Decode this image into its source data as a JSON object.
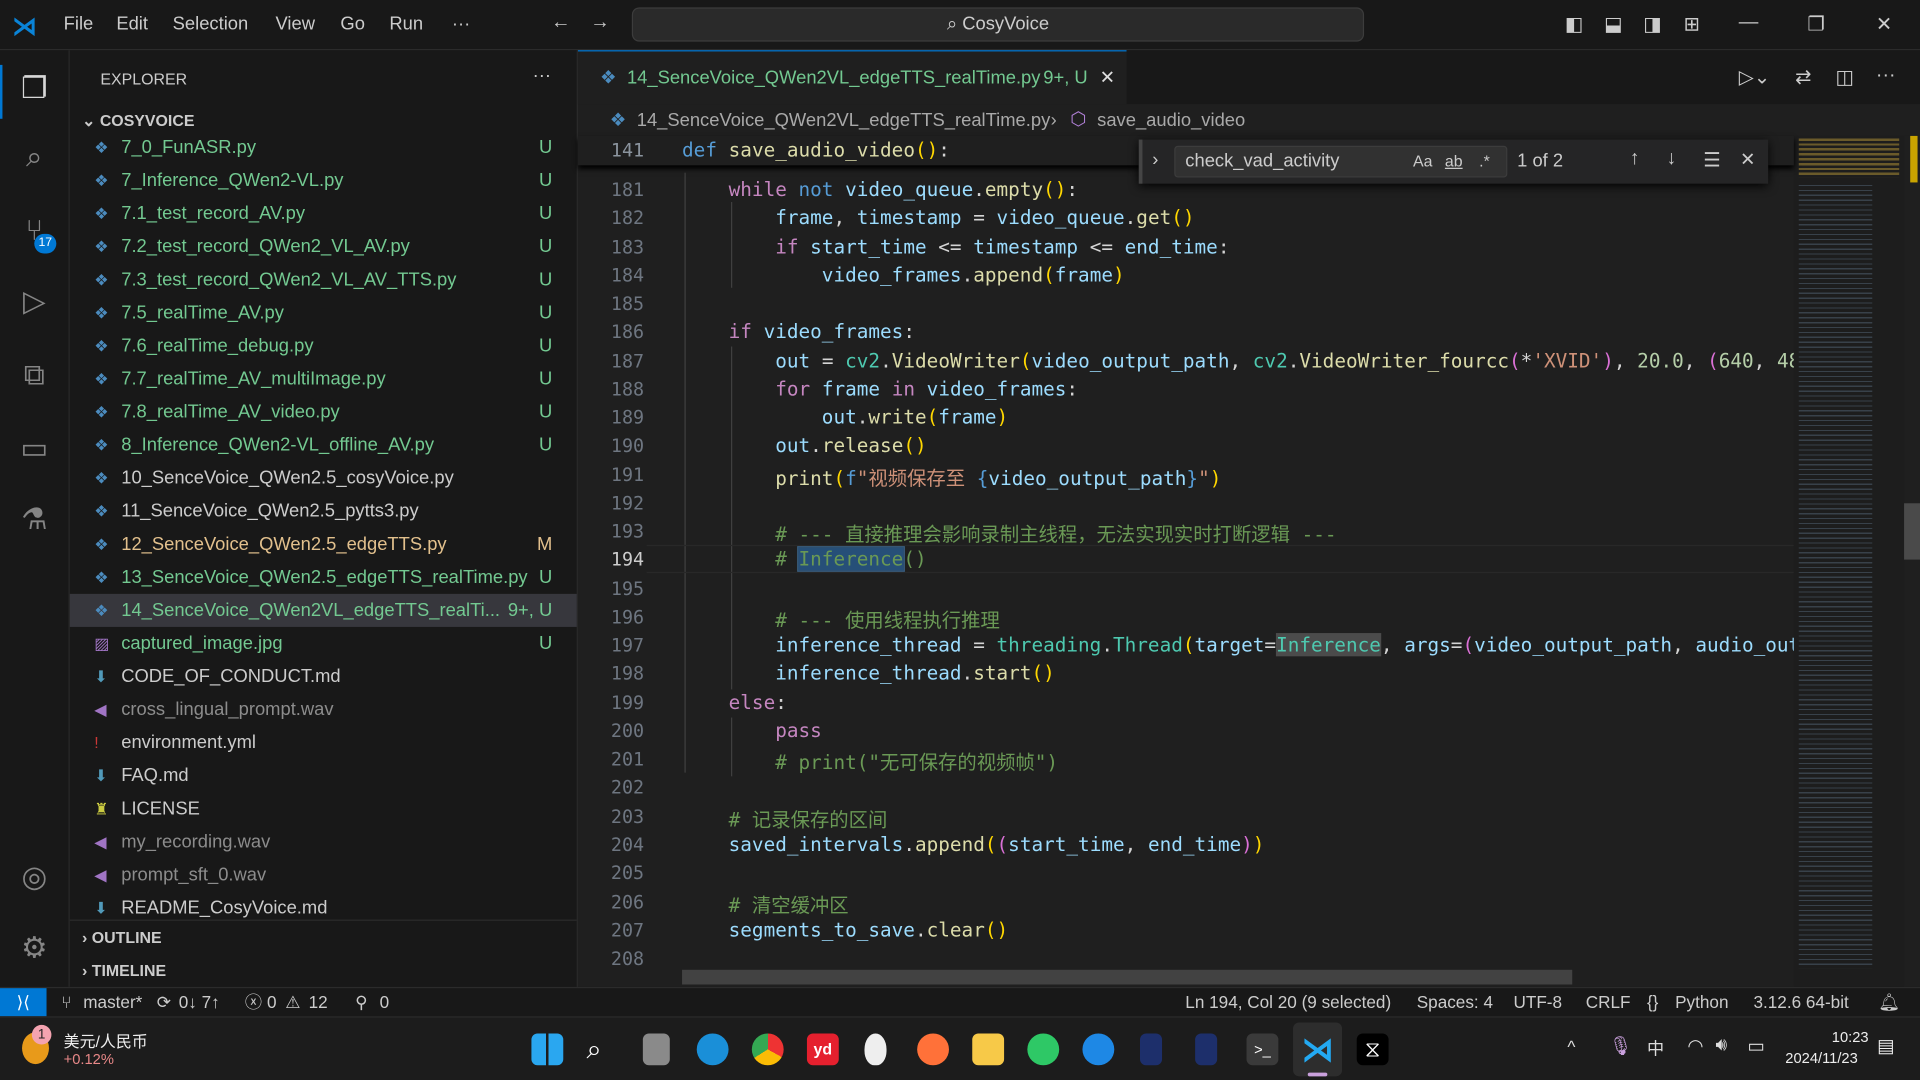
{
  "title_bar": {
    "menus": [
      "File",
      "Edit",
      "Selection",
      "View",
      "Go",
      "Run",
      "···"
    ],
    "search": "CosyVoice"
  },
  "activity_bar": {
    "source_control_badge": "17"
  },
  "explorer": {
    "title": "EXPLORER",
    "more": "···",
    "folder": "COSYVOICE",
    "files": [
      {
        "name": "7_0_FunASR.py",
        "status": "U",
        "type": "py",
        "color": "#73c991"
      },
      {
        "name": "7_Inference_QWen2-VL.py",
        "status": "U",
        "type": "py",
        "color": "#73c991"
      },
      {
        "name": "7.1_test_record_AV.py",
        "status": "U",
        "type": "py",
        "color": "#73c991"
      },
      {
        "name": "7.2_test_record_QWen2_VL_AV.py",
        "status": "U",
        "type": "py",
        "color": "#73c991"
      },
      {
        "name": "7.3_test_record_QWen2_VL_AV_TTS.py",
        "status": "U",
        "type": "py",
        "color": "#73c991"
      },
      {
        "name": "7.5_realTime_AV.py",
        "status": "U",
        "type": "py",
        "color": "#73c991"
      },
      {
        "name": "7.6_realTime_debug.py",
        "status": "U",
        "type": "py",
        "color": "#73c991"
      },
      {
        "name": "7.7_realTime_AV_multiImage.py",
        "status": "U",
        "type": "py",
        "color": "#73c991"
      },
      {
        "name": "7.8_realTime_AV_video.py",
        "status": "U",
        "type": "py",
        "color": "#73c991"
      },
      {
        "name": "8_Inference_QWen2-VL_offline_AV.py",
        "status": "U",
        "type": "py",
        "color": "#73c991"
      },
      {
        "name": "10_SenceVoice_QWen2.5_cosyVoice.py",
        "status": "",
        "type": "py",
        "color": "#cccccc"
      },
      {
        "name": "11_SenceVoice_QWen2.5_pytts3.py",
        "status": "",
        "type": "py",
        "color": "#cccccc"
      },
      {
        "name": "12_SenceVoice_QWen2.5_edgeTTS.py",
        "status": "M",
        "type": "py",
        "color": "#e2c08d"
      },
      {
        "name": "13_SenceVoice_QWen2.5_edgeTTS_realTime.py",
        "status": "U",
        "type": "py",
        "color": "#73c991"
      },
      {
        "name": "14_SenceVoice_QWen2VL_edgeTTS_realTi...",
        "status": "9+, U",
        "type": "py",
        "color": "#73c991",
        "selected": true
      },
      {
        "name": "captured_image.jpg",
        "status": "U",
        "type": "img",
        "color": "#73c991"
      },
      {
        "name": "CODE_OF_CONDUCT.md",
        "status": "",
        "type": "md",
        "color": "#cccccc"
      },
      {
        "name": "cross_lingual_prompt.wav",
        "status": "",
        "type": "wav",
        "color": "#8c8c8c"
      },
      {
        "name": "environment.yml",
        "status": "",
        "type": "yml",
        "color": "#cccccc"
      },
      {
        "name": "FAQ.md",
        "status": "",
        "type": "md",
        "color": "#cccccc"
      },
      {
        "name": "LICENSE",
        "status": "",
        "type": "lic",
        "color": "#cccccc"
      },
      {
        "name": "my_recording.wav",
        "status": "",
        "type": "wav",
        "color": "#8c8c8c"
      },
      {
        "name": "prompt_sft_0.wav",
        "status": "",
        "type": "wav",
        "color": "#8c8c8c"
      },
      {
        "name": "README_CosyVoice.md",
        "status": "",
        "type": "md",
        "color": "#cccccc"
      }
    ],
    "outline": "OUTLINE",
    "timeline": "TIMELINE"
  },
  "editor": {
    "tab": {
      "label": "14_SenceVoice_QWen2VL_edgeTTS_realTime.py",
      "badge": "9+, U"
    },
    "breadcrumb": {
      "file": "14_SenceVoice_QWen2VL_edgeTTS_realTime.py",
      "symbol": "save_audio_video"
    },
    "sticky": {
      "line": "141",
      "tokens": [
        [
          "bl",
          "def"
        ],
        [
          "op",
          " "
        ],
        [
          "fn",
          "save_audio_video"
        ],
        [
          "br",
          "()"
        ],
        [
          "op",
          ":"
        ]
      ]
    },
    "find": {
      "query": "check_vad_activity",
      "case": "Aa",
      "word": "ab",
      "regex": ".*",
      "result": "1 of 2"
    },
    "lines": [
      {
        "n": "181",
        "t": [
          [
            "op",
            "    "
          ],
          [
            "kw",
            "while"
          ],
          [
            "op",
            " "
          ],
          [
            "bl",
            "not"
          ],
          [
            "op",
            " "
          ],
          [
            "var",
            "video_queue"
          ],
          [
            "op",
            "."
          ],
          [
            "fn",
            "empty"
          ],
          [
            "br",
            "()"
          ],
          [
            "op",
            ":"
          ]
        ]
      },
      {
        "n": "182",
        "t": [
          [
            "op",
            "        "
          ],
          [
            "var",
            "frame"
          ],
          [
            "op",
            ", "
          ],
          [
            "var",
            "timestamp"
          ],
          [
            "op",
            " = "
          ],
          [
            "var",
            "video_queue"
          ],
          [
            "op",
            "."
          ],
          [
            "fn",
            "get"
          ],
          [
            "br",
            "()"
          ]
        ]
      },
      {
        "n": "183",
        "t": [
          [
            "op",
            "        "
          ],
          [
            "kw",
            "if"
          ],
          [
            "op",
            " "
          ],
          [
            "var",
            "start_time"
          ],
          [
            "op",
            " <= "
          ],
          [
            "var",
            "timestamp"
          ],
          [
            "op",
            " <= "
          ],
          [
            "var",
            "end_time"
          ],
          [
            "op",
            ":"
          ]
        ]
      },
      {
        "n": "184",
        "t": [
          [
            "op",
            "            "
          ],
          [
            "var",
            "video_frames"
          ],
          [
            "op",
            "."
          ],
          [
            "fn",
            "append"
          ],
          [
            "br",
            "("
          ],
          [
            "var",
            "frame"
          ],
          [
            "br",
            ")"
          ]
        ]
      },
      {
        "n": "185",
        "t": []
      },
      {
        "n": "186",
        "t": [
          [
            "op",
            "    "
          ],
          [
            "kw",
            "if"
          ],
          [
            "op",
            " "
          ],
          [
            "var",
            "video_frames"
          ],
          [
            "op",
            ":"
          ]
        ]
      },
      {
        "n": "187",
        "t": [
          [
            "op",
            "        "
          ],
          [
            "var",
            "out"
          ],
          [
            "op",
            " = "
          ],
          [
            "cls",
            "cv2"
          ],
          [
            "op",
            "."
          ],
          [
            "fn",
            "VideoWriter"
          ],
          [
            "br",
            "("
          ],
          [
            "var",
            "video_output_path"
          ],
          [
            "op",
            ", "
          ],
          [
            "cls",
            "cv2"
          ],
          [
            "op",
            "."
          ],
          [
            "fn",
            "VideoWriter_fourcc"
          ],
          [
            "br2",
            "("
          ],
          [
            "op",
            "*"
          ],
          [
            "str",
            "'XVID'"
          ],
          [
            "br2",
            ")"
          ],
          [
            "op",
            ", "
          ],
          [
            "num",
            "20.0"
          ],
          [
            "op",
            ", "
          ],
          [
            "br2",
            "("
          ],
          [
            "num",
            "640"
          ],
          [
            "op",
            ", "
          ],
          [
            "num",
            "48"
          ]
        ]
      },
      {
        "n": "188",
        "t": [
          [
            "op",
            "        "
          ],
          [
            "kw",
            "for"
          ],
          [
            "op",
            " "
          ],
          [
            "var",
            "frame"
          ],
          [
            "op",
            " "
          ],
          [
            "kw",
            "in"
          ],
          [
            "op",
            " "
          ],
          [
            "var",
            "video_frames"
          ],
          [
            "op",
            ":"
          ]
        ]
      },
      {
        "n": "189",
        "t": [
          [
            "op",
            "            "
          ],
          [
            "var",
            "out"
          ],
          [
            "op",
            "."
          ],
          [
            "fn",
            "write"
          ],
          [
            "br",
            "("
          ],
          [
            "var",
            "frame"
          ],
          [
            "br",
            ")"
          ]
        ]
      },
      {
        "n": "190",
        "t": [
          [
            "op",
            "        "
          ],
          [
            "var",
            "out"
          ],
          [
            "op",
            "."
          ],
          [
            "fn",
            "release"
          ],
          [
            "br",
            "()"
          ]
        ]
      },
      {
        "n": "191",
        "t": [
          [
            "op",
            "        "
          ],
          [
            "fn",
            "print"
          ],
          [
            "br",
            "("
          ],
          [
            "bl",
            "f"
          ],
          [
            "str",
            "\"视频保存至 "
          ],
          [
            "bl",
            "{"
          ],
          [
            "var",
            "video_output_path"
          ],
          [
            "bl",
            "}"
          ],
          [
            "str",
            "\""
          ],
          [
            "br",
            ")"
          ]
        ]
      },
      {
        "n": "192",
        "t": []
      },
      {
        "n": "193",
        "t": [
          [
            "op",
            "        "
          ],
          [
            "cm",
            "# --- 直接推理会影响录制主线程，无法实现实时打断逻辑 ---"
          ]
        ]
      },
      {
        "n": "194",
        "t": [
          [
            "op",
            "        "
          ],
          [
            "cm",
            "# "
          ],
          [
            "sel",
            "Inference"
          ],
          [
            "cm",
            "()"
          ]
        ]
      },
      {
        "n": "195",
        "t": []
      },
      {
        "n": "196",
        "t": [
          [
            "op",
            "        "
          ],
          [
            "cm",
            "# --- 使用线程执行推理"
          ]
        ]
      },
      {
        "n": "197",
        "t": [
          [
            "op",
            "        "
          ],
          [
            "var",
            "inference_thread"
          ],
          [
            "op",
            " = "
          ],
          [
            "cls",
            "threading"
          ],
          [
            "op",
            "."
          ],
          [
            "cls",
            "Thread"
          ],
          [
            "br",
            "("
          ],
          [
            "var",
            "target"
          ],
          [
            "op",
            "="
          ],
          [
            "hl",
            "Inference"
          ],
          [
            "op",
            ", "
          ],
          [
            "var",
            "args"
          ],
          [
            "op",
            "="
          ],
          [
            "br2",
            "("
          ],
          [
            "var",
            "video_output_path"
          ],
          [
            "op",
            ", "
          ],
          [
            "var",
            "audio_out"
          ]
        ]
      },
      {
        "n": "198",
        "t": [
          [
            "op",
            "        "
          ],
          [
            "var",
            "inference_thread"
          ],
          [
            "op",
            "."
          ],
          [
            "fn",
            "start"
          ],
          [
            "br",
            "()"
          ]
        ]
      },
      {
        "n": "199",
        "t": [
          [
            "op",
            "    "
          ],
          [
            "kw",
            "else"
          ],
          [
            "op",
            ":"
          ]
        ]
      },
      {
        "n": "200",
        "t": [
          [
            "op",
            "        "
          ],
          [
            "kw",
            "pass"
          ]
        ]
      },
      {
        "n": "201",
        "t": [
          [
            "op",
            "        "
          ],
          [
            "cm",
            "# print(\"无可保存的视频帧\")"
          ]
        ]
      },
      {
        "n": "202",
        "t": []
      },
      {
        "n": "203",
        "t": [
          [
            "op",
            "    "
          ],
          [
            "cm",
            "# 记录保存的区间"
          ]
        ]
      },
      {
        "n": "204",
        "t": [
          [
            "op",
            "    "
          ],
          [
            "var",
            "saved_intervals"
          ],
          [
            "op",
            "."
          ],
          [
            "fn",
            "append"
          ],
          [
            "br",
            "("
          ],
          [
            "br2",
            "("
          ],
          [
            "var",
            "start_time"
          ],
          [
            "op",
            ", "
          ],
          [
            "var",
            "end_time"
          ],
          [
            "br2",
            ")"
          ],
          [
            "br",
            ")"
          ]
        ]
      },
      {
        "n": "205",
        "t": []
      },
      {
        "n": "206",
        "t": [
          [
            "op",
            "    "
          ],
          [
            "cm",
            "# 清空缓冲区"
          ]
        ]
      },
      {
        "n": "207",
        "t": [
          [
            "op",
            "    "
          ],
          [
            "var",
            "segments_to_save"
          ],
          [
            "op",
            "."
          ],
          [
            "fn",
            "clear"
          ],
          [
            "br",
            "()"
          ]
        ]
      },
      {
        "n": "208",
        "t": []
      }
    ]
  },
  "status_bar": {
    "branch": "master*",
    "sync": "0↓ 7↑",
    "errors": "0",
    "warnings": "12",
    "ports": "0",
    "position": "Ln 194, Col 20 (9 selected)",
    "spaces": "Spaces: 4",
    "encoding": "UTF-8",
    "eol": "CRLF",
    "language": "Python",
    "interpreter": "3.12.6 64-bit",
    "accent": "#0078d4"
  },
  "taskbar": {
    "widget_title": "美元/人民币",
    "widget_value": "+0.12%",
    "widget_badge": "1",
    "ime": "中",
    "time": "10:23",
    "date": "2024/11/23"
  }
}
